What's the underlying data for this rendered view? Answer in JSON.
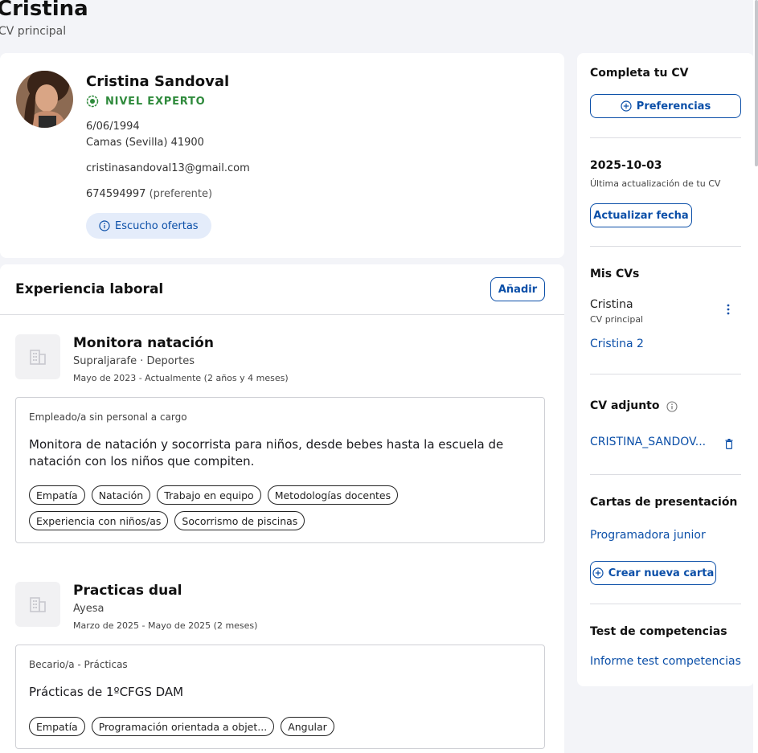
{
  "header": {
    "title": "Cristina",
    "subtitle": "CV principal"
  },
  "profile": {
    "name": "Cristina Sandoval",
    "level": "NIVEL EXPERTO",
    "birthdate": "6/06/1994",
    "location": "Camas (Sevilla) 41900",
    "email": "cristinasandoval13@gmail.com",
    "phone": "674594997",
    "phone_note": "(preferente)",
    "offers_chip": "Escucho ofertas"
  },
  "experience": {
    "title": "Experiencia laboral",
    "add_label": "Añadir",
    "jobs": [
      {
        "title": "Monitora natación",
        "company": "Supraljarafe",
        "sector": "Deportes",
        "dates": "Mayo de 2023 - Actualmente (2 años y 4 meses)",
        "type": "Empleado/a sin personal a cargo",
        "description": "Monitora de natación y socorrista para niños, desde bebes hasta la escuela de natación con los niños que compiten.",
        "tags": [
          "Empatía",
          "Natación",
          "Trabajo en equipo",
          "Metodologías docentes",
          "Experiencia con niños/as",
          "Socorrismo de piscinas"
        ]
      },
      {
        "title": "Practicas dual",
        "company": "Ayesa",
        "sector": "",
        "dates": "Marzo de 2025 - Mayo de 2025 (2 meses)",
        "type": "Becario/a - Prácticas",
        "description": "Prácticas de 1ºCFGS DAM",
        "tags": [
          "Empatía",
          "Programación orientada a objet...",
          "Angular"
        ]
      }
    ]
  },
  "sidebar": {
    "complete_title": "Completa tu CV",
    "preferences_label": "Preferencias",
    "update_date": "2025-10-03",
    "update_caption": "Última actualización de tu CV",
    "update_button": "Actualizar fecha",
    "mycvs_title": "Mis CVs",
    "cv1_name": "Cristina",
    "cv1_caption": "CV principal",
    "cv2_name": "Cristina 2",
    "attached_title": "CV adjunto",
    "attached_file": "CRISTINA_SANDOV...",
    "letters_title": "Cartas de presentación",
    "letter1": "Programadora junior",
    "new_letter_label": "Crear nueva carta",
    "test_title": "Test de competencias",
    "test_link": "Informe test competencias"
  },
  "icons": {
    "level": "badge-check-icon",
    "info": "info-icon",
    "plus": "plus-circle-icon",
    "menu": "vertical-dots-icon",
    "delete": "trash-icon",
    "company": "building-icon"
  },
  "colors": {
    "accent": "#0b4fa8",
    "level": "#2f8a3c",
    "background": "#f3f4f8"
  }
}
